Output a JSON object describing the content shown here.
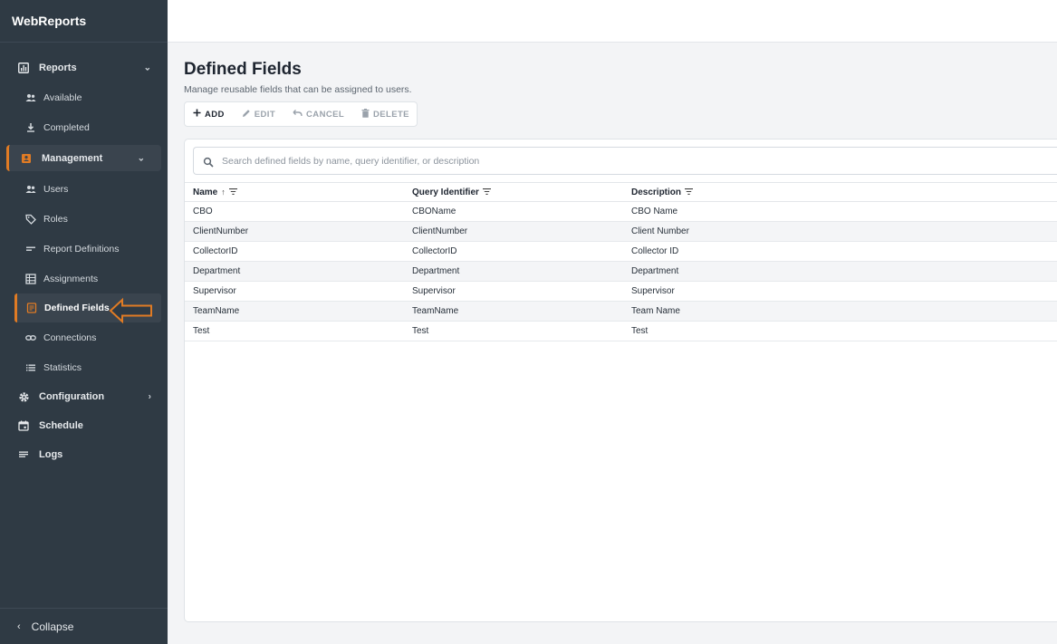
{
  "app": {
    "title": "WebReports"
  },
  "sidebar": {
    "reports": {
      "label": "Reports",
      "items": [
        {
          "label": "Available"
        },
        {
          "label": "Completed"
        }
      ]
    },
    "management": {
      "label": "Management",
      "items": [
        {
          "label": "Users"
        },
        {
          "label": "Roles"
        },
        {
          "label": "Report Definitions"
        },
        {
          "label": "Assignments"
        },
        {
          "label": "Defined Fields"
        },
        {
          "label": "Connections"
        },
        {
          "label": "Statistics"
        }
      ]
    },
    "configuration": {
      "label": "Configuration"
    },
    "schedule": {
      "label": "Schedule"
    },
    "logs": {
      "label": "Logs"
    },
    "collapse": {
      "label": "Collapse"
    }
  },
  "page": {
    "title": "Defined Fields",
    "subtitle": "Manage reusable fields that can be assigned to users."
  },
  "toolbar": {
    "add": "ADD",
    "edit": "EDIT",
    "cancel": "CANCEL",
    "delete": "DELETE"
  },
  "search": {
    "placeholder": "Search defined fields by name, query identifier, or description"
  },
  "table": {
    "columns": [
      {
        "label": "Name"
      },
      {
        "label": "Query Identifier"
      },
      {
        "label": "Description"
      }
    ],
    "rows": [
      {
        "name": "CBO",
        "query": "CBOName",
        "description": "CBO Name"
      },
      {
        "name": "ClientNumber",
        "query": "ClientNumber",
        "description": "Client Number"
      },
      {
        "name": "CollectorID",
        "query": "CollectorID",
        "description": "Collector ID"
      },
      {
        "name": "Department",
        "query": "Department",
        "description": "Department"
      },
      {
        "name": "Supervisor",
        "query": "Supervisor",
        "description": "Supervisor"
      },
      {
        "name": "TeamName",
        "query": "TeamName",
        "description": "Team Name"
      },
      {
        "name": "Test",
        "query": "Test",
        "description": "Test"
      }
    ]
  },
  "colors": {
    "accent": "#e07b24",
    "sidebar_bg": "#2f3a44"
  }
}
